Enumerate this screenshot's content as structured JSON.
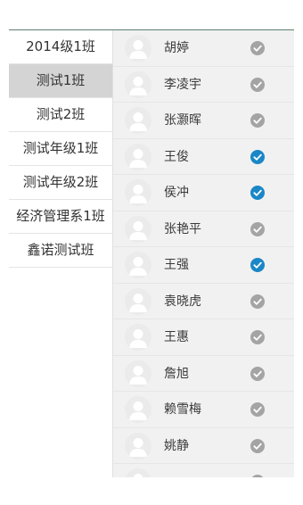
{
  "classes": [
    {
      "label": "2014级1班",
      "selected": false
    },
    {
      "label": "测试1班",
      "selected": true
    },
    {
      "label": "测试2班",
      "selected": false
    },
    {
      "label": "测试年级1班",
      "selected": false
    },
    {
      "label": "测试年级2班",
      "selected": false
    },
    {
      "label": "经济管理系1班",
      "selected": false
    },
    {
      "label": "鑫诺测试班",
      "selected": false
    }
  ],
  "students": [
    {
      "name": "胡婷",
      "checked": false
    },
    {
      "name": "李凌宇",
      "checked": false
    },
    {
      "name": "张灏晖",
      "checked": false
    },
    {
      "name": "王俊",
      "checked": true
    },
    {
      "name": "侯冲",
      "checked": true
    },
    {
      "name": "张艳平",
      "checked": false
    },
    {
      "name": "王强",
      "checked": true
    },
    {
      "name": "袁晓虎",
      "checked": false
    },
    {
      "name": "王惠",
      "checked": false
    },
    {
      "name": "詹旭",
      "checked": false
    },
    {
      "name": "赖雪梅",
      "checked": false
    },
    {
      "name": "姚静",
      "checked": false
    },
    {
      "name": "",
      "checked": false
    }
  ],
  "icons": {
    "avatar": "person-avatar-icon",
    "check_on": "check-circle-filled-icon",
    "check_off": "check-circle-gray-icon"
  },
  "colors": {
    "selected_class_bg": "#d4d4d4",
    "check_on": "#1a87c7",
    "check_off": "#a4a4a4",
    "panel_bg": "#f1f1f1"
  }
}
